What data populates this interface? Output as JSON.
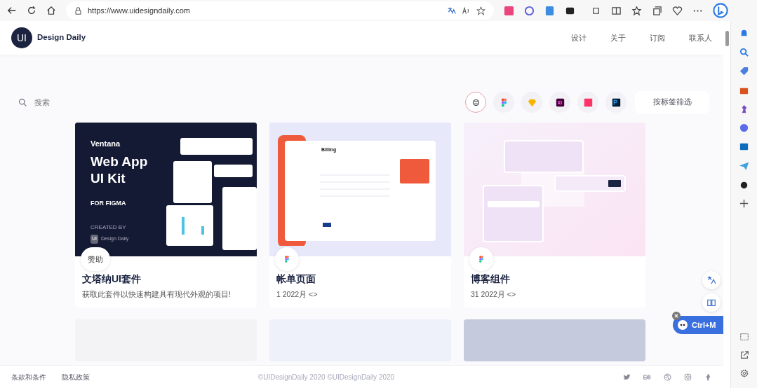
{
  "browser": {
    "url": "https://www.uidesigndaily.com"
  },
  "header": {
    "logo_mark": "UI",
    "logo_text": "Design Daily",
    "nav": [
      "设计",
      "关于",
      "订阅",
      "联系人"
    ]
  },
  "search": {
    "placeholder": "搜索"
  },
  "filters": [
    {
      "kind": "all",
      "selected": true
    },
    {
      "kind": "figma",
      "selected": false
    },
    {
      "kind": "sketch",
      "selected": false
    },
    {
      "kind": "xd",
      "selected": false
    },
    {
      "kind": "invision",
      "selected": false
    },
    {
      "kind": "photoshop",
      "selected": false
    }
  ],
  "filter_button": "按标签筛选",
  "cards": [
    {
      "kind": "ventana",
      "badge": "赞助",
      "title": "文塔纳UI套件",
      "subtitle": "获取此套件以快速构建具有现代外观的项目!",
      "preview": {
        "brand": "Ventana",
        "headline": "Web App",
        "headline2": "UI Kit",
        "tool": "FOR FIGMA",
        "credit_label": "CREATED BY",
        "credit_mark": "UI",
        "credit": "Design Daily"
      }
    },
    {
      "kind": "billing",
      "title": "帐单页面",
      "subtitle": "1 2022月 <>",
      "preview": {
        "heading": "Billing"
      }
    },
    {
      "kind": "blog",
      "title": "博客组件",
      "subtitle": "31 2022月 <>"
    }
  ],
  "floating": {
    "shortcut": "Ctrl+M"
  },
  "footer": {
    "links": [
      "条款和条件",
      "隐私政策"
    ],
    "copyright": "©UIDesignDaily 2020 ©UIDesignDaily 2020"
  }
}
